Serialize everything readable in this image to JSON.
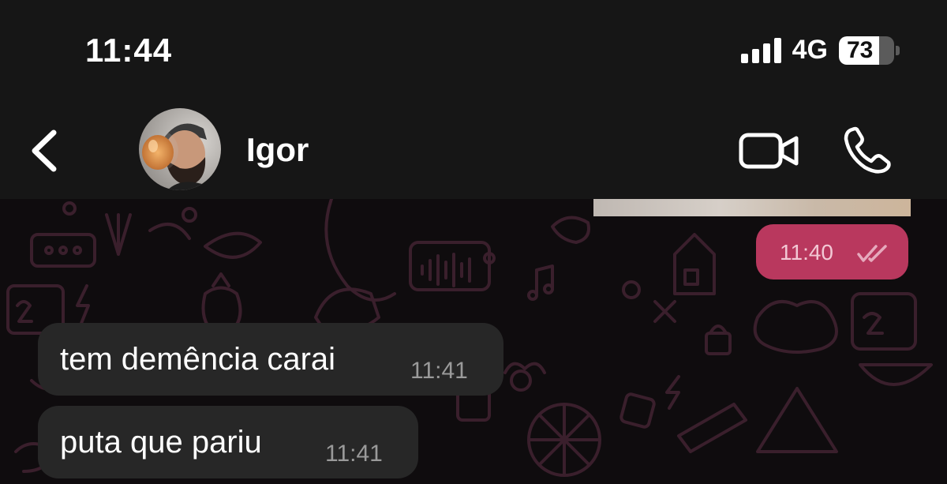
{
  "status_bar": {
    "time": "11:44",
    "network": "4G",
    "battery_percent": "73",
    "battery_level": 0.73
  },
  "header": {
    "contact_name": "Igor",
    "icons": {
      "back": "chevron-left-icon",
      "video": "video-camera-icon",
      "call": "phone-icon"
    }
  },
  "messages": [
    {
      "direction": "outgoing",
      "type": "media",
      "time": "11:40",
      "status": "read"
    },
    {
      "direction": "incoming",
      "text": "tem demência carai",
      "time": "11:41"
    },
    {
      "direction": "incoming",
      "text": "puta que pariu",
      "time": "11:41"
    }
  ],
  "colors": {
    "outgoing_bubble": "#b9385e",
    "incoming_bubble": "#272727",
    "wallpaper_doodle": "#3a1f2c",
    "header_bg": "#161616"
  }
}
